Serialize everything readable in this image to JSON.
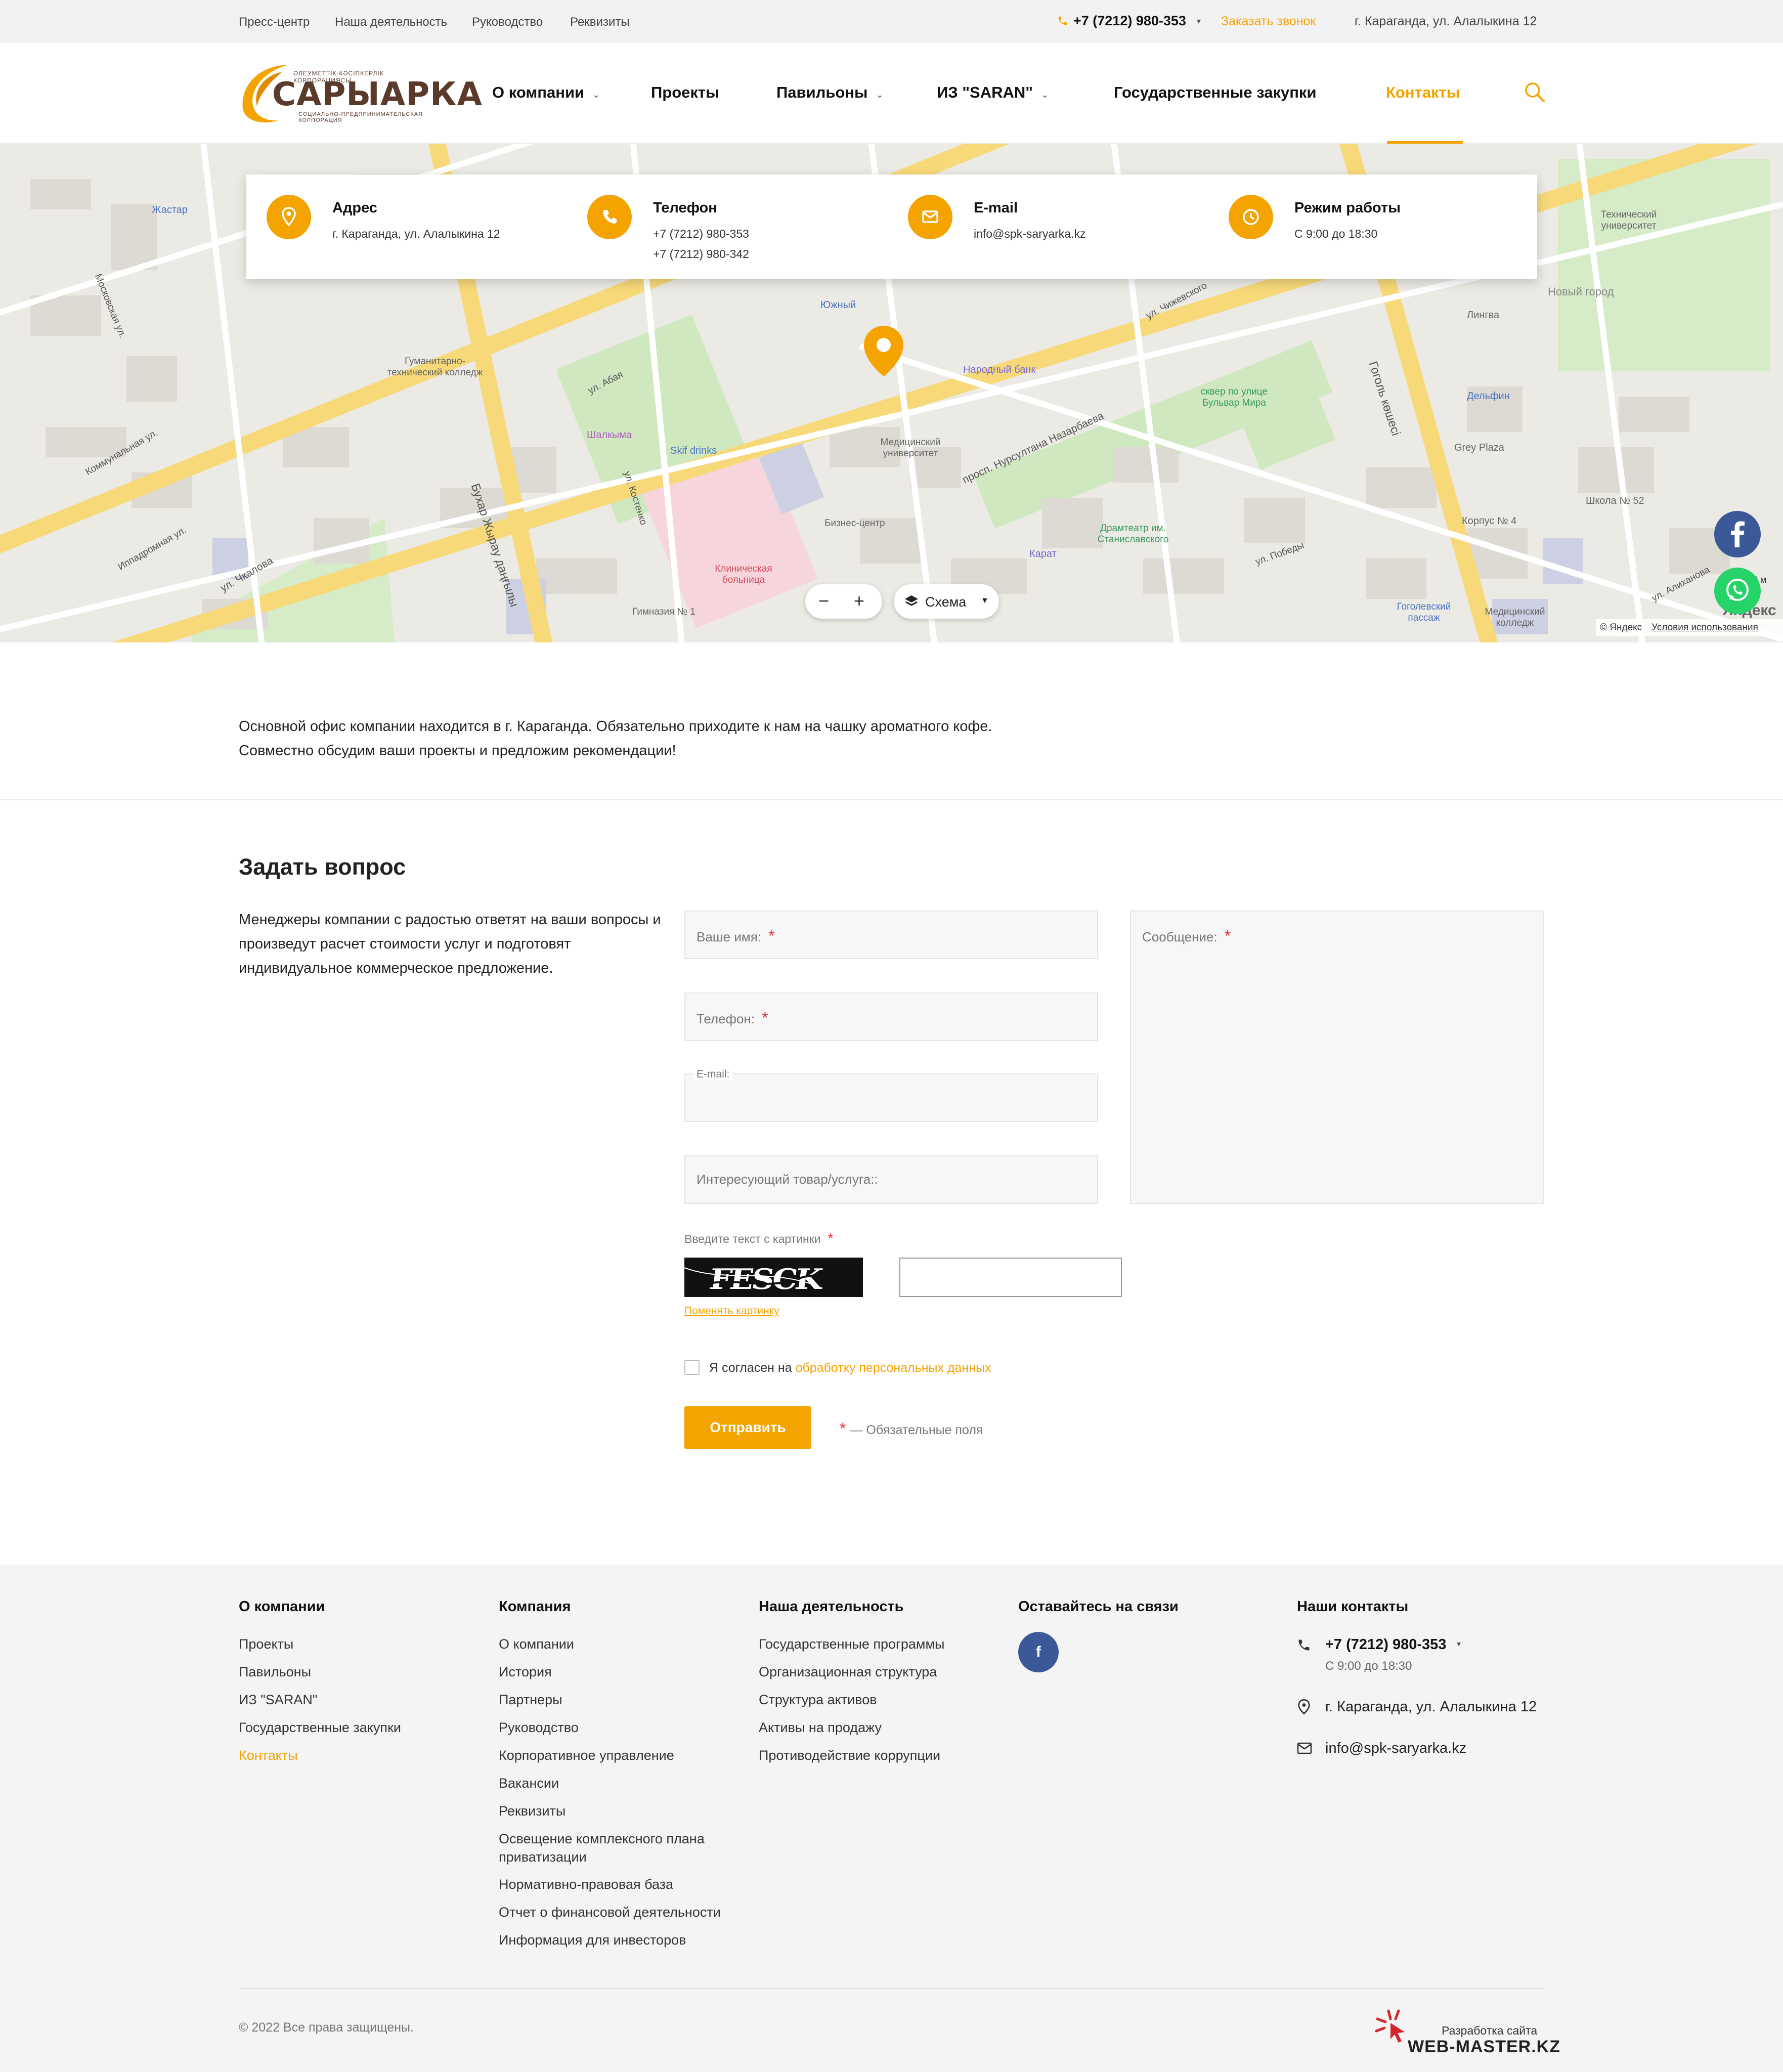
{
  "topbar": {
    "links": [
      "Пресс-центр",
      "Наша деятельность",
      "Руководство",
      "Реквизиты"
    ],
    "phone": "+7 (7212) 980-353",
    "callback": "Заказать звонок",
    "address": "г. Караганда, ул. Алалыкина 12"
  },
  "logo": {
    "name": "САРЫАРКА",
    "tagline_top": "ӘЛЕУМЕТТІК-КӘСІПКЕРЛІК КОРПОРАЦИЯСЫ",
    "tagline_bottom": "СОЦИАЛЬНО-ПРЕДПРИНИМАТЕЛЬСКАЯ КОРПОРАЦИЯ"
  },
  "nav": {
    "items": [
      {
        "label": "О компании",
        "dropdown": true
      },
      {
        "label": "Проекты",
        "dropdown": false
      },
      {
        "label": "Павильоны",
        "dropdown": true
      },
      {
        "label": "ИЗ \"SARAN\"",
        "dropdown": true
      },
      {
        "label": "Государственные закупки",
        "dropdown": false
      },
      {
        "label": "Контакты",
        "dropdown": false,
        "active": true
      }
    ]
  },
  "contacts_box": {
    "address": {
      "title": "Адрес",
      "value": "г. Караганда, ул. Алалыкина 12"
    },
    "phone": {
      "title": "Телефон",
      "value1": "+7 (7212) 980-353",
      "value2": "+7 (7212) 980-342"
    },
    "email": {
      "title": "E-mail",
      "value": "info@spk-saryarka.kz"
    },
    "hours": {
      "title": "Режим работы",
      "value": "С 9:00 до 18:30"
    }
  },
  "map": {
    "labels": [
      "Жастар",
      "Гуманитарно-технический колледж",
      "Шалкыма",
      "Skif drinks",
      "Южный",
      "Народный банк",
      "Медицинский университет",
      "Бизнес-центр",
      "Клиническая больница",
      "Гимназия № 1",
      "Карат",
      "Драмтеатр им. Станиславского",
      "сквер по улице Бульвар Мира",
      "Технический университет",
      "Новый город",
      "Лингва",
      "Дельфин",
      "Grey Plaza",
      "Школа № 52",
      "Корпус № 4",
      "Гоголевский пассаж",
      "Медицинский колледж",
      "ул. Абая",
      "просп. Нурсултана Назарбаева",
      "Бухар Жырау даңғылы",
      "Гоголь көшесі",
      "ул. Чкалова",
      "Иппадромная ул.",
      "Московская ул.",
      "Коммунальная ул.",
      "ул. Костенко",
      "ул. Победы",
      "ул. Алиханова",
      "ул. Чижевского"
    ],
    "zoom_minus": "−",
    "zoom_plus": "+",
    "layer": "Схема",
    "copyright": "© Яндекс",
    "terms": "Условия использования",
    "brand": "Яндекс",
    "scale": "0 м"
  },
  "intro": {
    "line1": "Основной офис компании находится в г. Караганда. Обязательно приходите к нам на чашку ароматного кофе.",
    "line2": "Совместно обсудим ваши проекты и предложим рекомендации!"
  },
  "form": {
    "title": "Задать вопрос",
    "description": "Менеджеры компании с радостью ответят на ваши вопросы и произведут расчет стоимости услуг и подготовят индивидуальное коммерческое предложение.",
    "name_label": "Ваше имя:",
    "phone_label": "Телефон:",
    "email_label": "E-mail:",
    "product_label": "Интересующий товар/услуга::",
    "message_label": "Сообщение:",
    "captcha_label": "Введите текст с картинки",
    "captcha_text": "FESCK",
    "captcha_refresh": "Поменять картинку",
    "agree_prefix": "Я согласен на",
    "agree_link": "обработку персональных данных",
    "submit": "Отправить",
    "required_note": "— Обязательные поля",
    "req_mark": "*"
  },
  "footer": {
    "col1": {
      "title": "О компании",
      "items": [
        "Проекты",
        "Павильоны",
        "ИЗ \"SARAN\"",
        "Государственные закупки",
        "Контакты"
      ]
    },
    "col2": {
      "title": "Компания",
      "items": [
        "О компании",
        "История",
        "Партнеры",
        "Руководство",
        "Корпоративное управление",
        "Вакансии",
        "Реквизиты",
        "Освещение комплексного плана приватизации",
        "Нормативно-правовая база",
        "Отчет о финансовой деятельности",
        "Информация для инвесторов"
      ]
    },
    "col3": {
      "title": "Наша деятельность",
      "items": [
        "Государственные программы",
        "Организационная структура",
        "Структура активов",
        "Активы на продажу",
        "Противодействие коррупции"
      ]
    },
    "col4": {
      "title": "Оставайтесь на связи",
      "fb": "f"
    },
    "col5": {
      "title": "Наши контакты",
      "phone": "+7 (7212) 980-353",
      "hours": "С 9:00 до 18:30",
      "address": "г. Караганда, ул. Алалыкина 12",
      "email": "info@spk-saryarka.kz"
    },
    "copyright": "© 2022 Все права защищены.",
    "dev_label": "Разработка сайта",
    "dev_name": "WEB-MASTER.KZ"
  },
  "colors": {
    "accent": "#f5a300",
    "facebook": "#3b5998",
    "whatsapp": "#25d366"
  }
}
